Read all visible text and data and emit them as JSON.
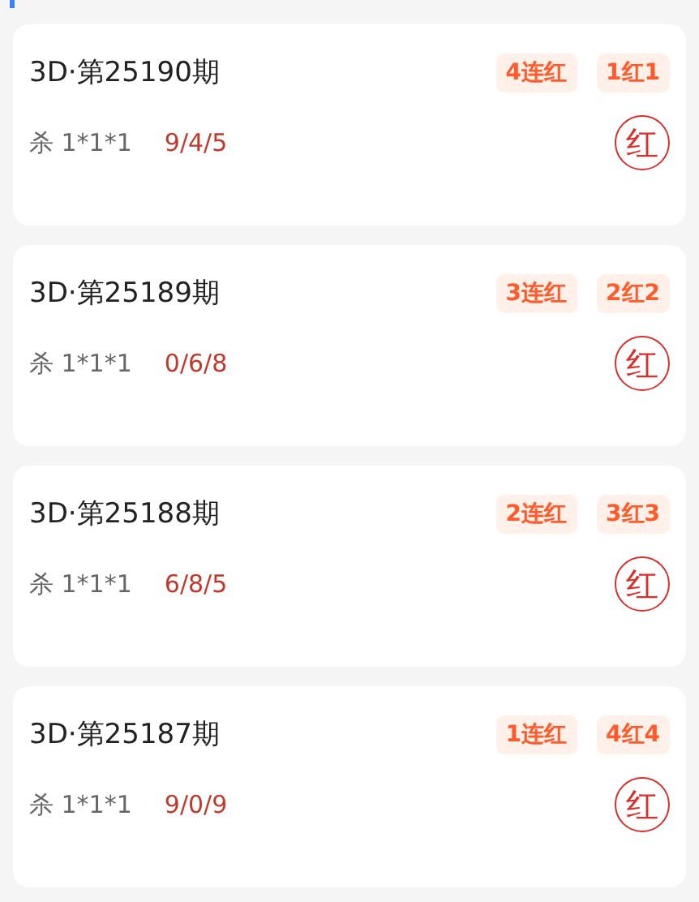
{
  "draws": [
    {
      "title": "3D·第25190期",
      "kill": "杀 1*1*1",
      "numbers": "9/4/5",
      "tags": [
        "4连红",
        "1红1"
      ],
      "result": "红"
    },
    {
      "title": "3D·第25189期",
      "kill": "杀 1*1*1",
      "numbers": "0/6/8",
      "tags": [
        "3连红",
        "2红2"
      ],
      "result": "红"
    },
    {
      "title": "3D·第25188期",
      "kill": "杀 1*1*1",
      "numbers": "6/8/5",
      "tags": [
        "2连红",
        "3红3"
      ],
      "result": "红"
    },
    {
      "title": "3D·第25187期",
      "kill": "杀 1*1*1",
      "numbers": "9/0/9",
      "tags": [
        "1连红",
        "4红4"
      ],
      "result": "红"
    }
  ]
}
